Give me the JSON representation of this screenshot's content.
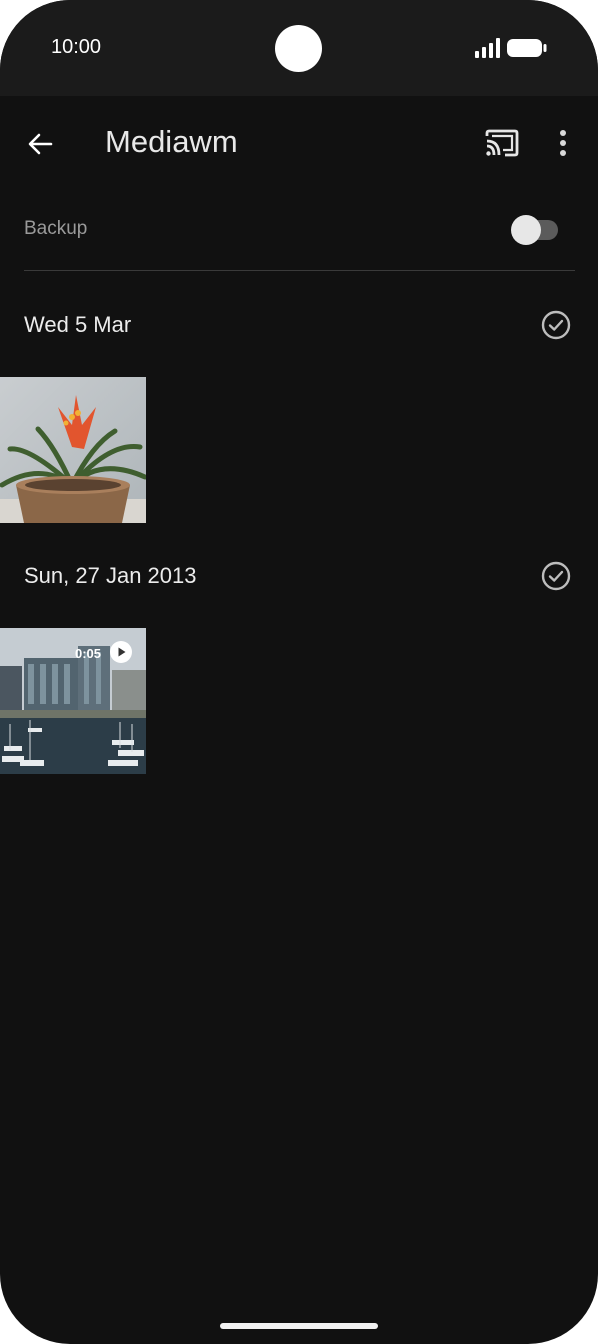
{
  "status": {
    "time": "10:00"
  },
  "header": {
    "title": "Mediawm",
    "back_icon": "arrow-back-icon",
    "cast_icon": "cast-icon",
    "more_icon": "more-vert-icon"
  },
  "backup": {
    "label": "Backup",
    "enabled": false
  },
  "sections": [
    {
      "date": "Wed 5 Mar",
      "item": {
        "type": "photo",
        "subject": "potted bromeliad plant"
      }
    },
    {
      "date": "Sun, 27 Jan 2013",
      "item": {
        "type": "video",
        "duration": "0:05",
        "subject": "marina with office buildings"
      }
    }
  ],
  "colors": {
    "background": "#111111",
    "statusbar": "#1b1b1b",
    "text": "#ececec",
    "muted": "#9a9a9a"
  }
}
